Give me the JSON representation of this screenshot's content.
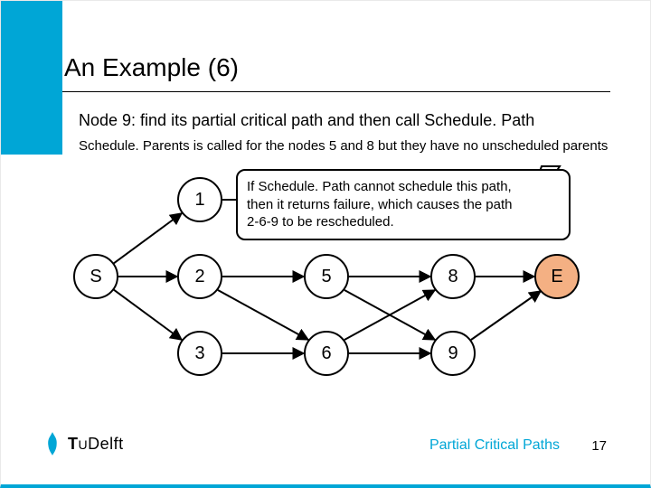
{
  "title": "An Example (6)",
  "subtitle": "Node 9: find its partial critical path and then call Schedule. Path",
  "note": "Schedule. Parents is called for the nodes 5 and 8 but they have no unscheduled parents",
  "callout": {
    "line1": "If Schedule. Path cannot schedule this path,",
    "line2": "then it returns failure, which causes the path",
    "line3": "2-6-9 to be rescheduled."
  },
  "nodes": {
    "S": "S",
    "n1": "1",
    "n2": "2",
    "n3": "3",
    "n5": "5",
    "n6": "6",
    "n8": "8",
    "n9": "9",
    "E": "E"
  },
  "footer": {
    "logo_text": "Delft",
    "label": "Partial Critical Paths",
    "page": "17"
  },
  "colors": {
    "teal": "#00a6d6",
    "highlight_fill": "#f4b083"
  }
}
